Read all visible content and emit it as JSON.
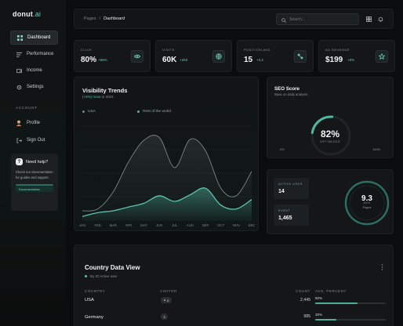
{
  "brand": {
    "name": "donut",
    "suffix": ".ai"
  },
  "sidebar": {
    "items": [
      {
        "label": "Dashboard",
        "icon": "grid-icon",
        "active": true
      },
      {
        "label": "Performance",
        "icon": "bars-icon"
      },
      {
        "label": "Income",
        "icon": "wallet-icon"
      },
      {
        "label": "Settings",
        "icon": "gear-icon"
      }
    ],
    "account_label": "ACCOUNT",
    "account_items": [
      {
        "label": "Profile",
        "icon": "user-icon"
      },
      {
        "label": "Sign Out",
        "icon": "logout-icon"
      }
    ],
    "help": {
      "title": "Need help?",
      "text": "Check our documentation for guides and support.",
      "button": "Documentation"
    }
  },
  "header": {
    "breadcrumb_parent": "Pages",
    "breadcrumb_sep": "/",
    "breadcrumb_current": "Dashboard",
    "search_placeholder": "Search..."
  },
  "stats": [
    {
      "label": "CLICK",
      "value": "80%",
      "change": "+66%",
      "icon": "eye-icon"
    },
    {
      "label": "VISITS",
      "value": "60K",
      "change": "+263",
      "icon": "globe-icon"
    },
    {
      "label": "POSITION AVG",
      "value": "15",
      "change": "+3.2",
      "icon": "position-icon"
    },
    {
      "label": "AD REVENUE",
      "value": "$199",
      "change": "+6%",
      "icon": "star-icon"
    }
  ],
  "visibility": {
    "title": "Visibility Trends",
    "subtitle_highlight": "(+5%) more",
    "subtitle_rest": " in 2024",
    "legend": [
      {
        "name": "USA",
        "color": "#7d8585"
      },
      {
        "name": "Rest of the world",
        "color": "#4fb5a1"
      }
    ]
  },
  "chart_data": {
    "type": "area",
    "categories": [
      "JAN",
      "FEB",
      "MAR",
      "APR",
      "MAY",
      "JUN",
      "JUL",
      "AUG",
      "SEP",
      "OCT",
      "NOV",
      "DEC"
    ],
    "series": [
      {
        "name": "USA",
        "values": [
          10,
          12,
          30,
          62,
          85,
          88,
          56,
          86,
          74,
          34,
          26,
          52
        ]
      },
      {
        "name": "Rest of the world",
        "values": [
          4,
          8,
          10,
          14,
          18,
          26,
          20,
          27,
          34,
          16,
          12,
          22
        ]
      }
    ],
    "ylim": [
      0,
      100
    ],
    "grid": true
  },
  "seo": {
    "title": "SEO Score",
    "subtitle": "Base on daily analysis",
    "value": "82%",
    "value_label": "OPTIMIZED",
    "score": 82,
    "min_label": "0%",
    "max_label": "100%"
  },
  "metrics": {
    "active_user_label": "ACTIVE USER",
    "active_user_value": "14",
    "event_label": "EVENT",
    "event_value": "1,465",
    "avg_label": "AVG",
    "avg_value": "9.3",
    "avg_unit": "Pages"
  },
  "country": {
    "title": "Country Data View",
    "subtitle": "By IO Active user",
    "headers": {
      "country": "COUNTRY",
      "visitor": "VISITOR",
      "count": "COUNT",
      "avg": "AVG. PERCENT"
    },
    "rows": [
      {
        "country": "USA",
        "visitor": "4",
        "count": "2,445",
        "percent": "60%",
        "fraction": 0.6
      },
      {
        "country": "Germany",
        "visitor": "3",
        "count": "985",
        "percent": "30%",
        "fraction": 0.3
      }
    ]
  }
}
